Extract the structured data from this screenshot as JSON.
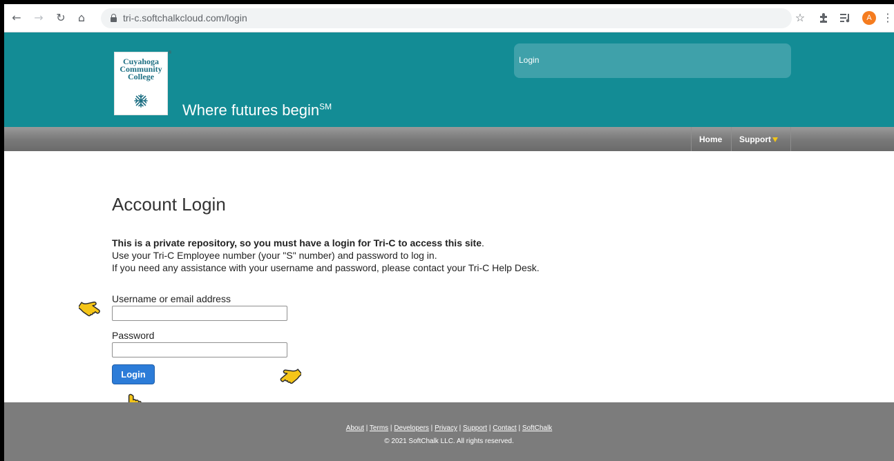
{
  "browser": {
    "url": "tri-c.softchalkcloud.com/login",
    "avatar_initial": "A",
    "icons": [
      "back-icon",
      "forward-icon",
      "reload-icon",
      "home-icon",
      "lock-icon",
      "star-icon",
      "extensions-icon",
      "media-icon",
      "avatar",
      "menu-icon"
    ]
  },
  "header": {
    "logo_lines": [
      "Cuyahoga",
      "Community",
      "College"
    ],
    "logo_reg": "®",
    "tagline": "Where futures begin",
    "tagline_mark": "SM",
    "login_box_label": "Login"
  },
  "nav": {
    "items": [
      {
        "label": "Home"
      },
      {
        "label": "Support",
        "icon": "caret-down-icon"
      }
    ]
  },
  "main": {
    "title": "Account Login",
    "intro_bold": "This is a private repository, so you must have a login for Tri-C to access this site",
    "intro_bold_end": ".",
    "intro_line2": "Use your Tri-C Employee number (your \"S\" number) and password to log in.",
    "intro_line3": "If you need any assistance with your username and password, please contact your Tri-C Help Desk.",
    "username_label": "Username or email address",
    "username_value": "",
    "password_label": "Password",
    "password_value": "",
    "login_button": "Login"
  },
  "footer": {
    "links": [
      "About",
      "Terms",
      "Developers",
      "Privacy",
      "Support",
      "Contact",
      "SoftChalk"
    ],
    "separator": " | ",
    "copyright": "© 2021 SoftChalk LLC. All rights reserved."
  },
  "colors": {
    "header_bg": "#138c95",
    "login_box_bg": "#3fa1aa",
    "button_bg": "#2c7cd8",
    "footer_bg": "#7c7c7c",
    "pointer_fill": "#f5c518"
  }
}
